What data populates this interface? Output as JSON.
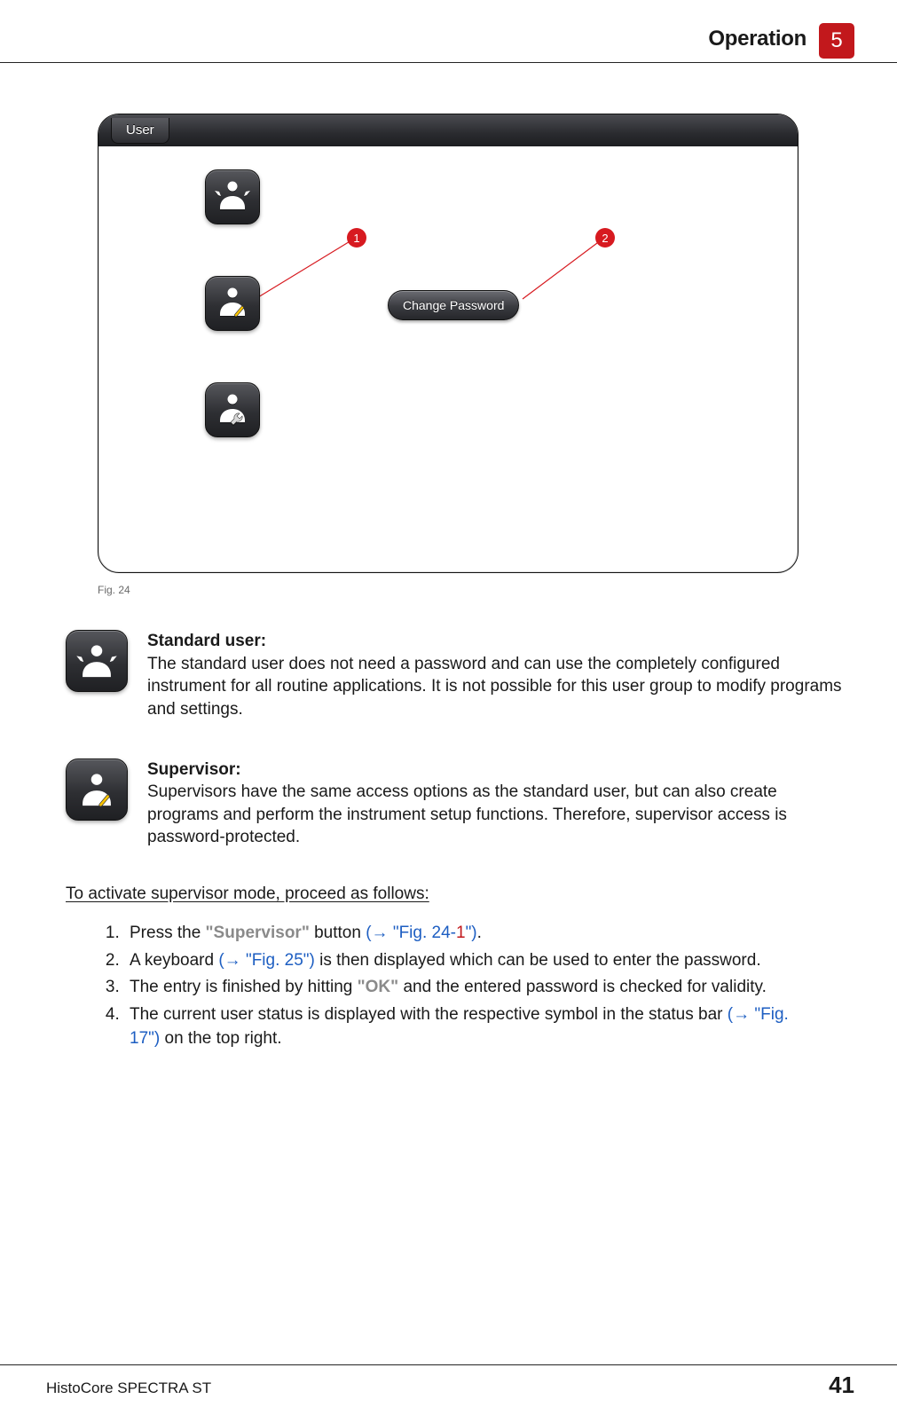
{
  "header": {
    "section_title": "Operation",
    "chapter_number": "5"
  },
  "panel": {
    "tab_label": "User",
    "change_password_label": "Change Password",
    "callout_1": "1",
    "callout_2": "2"
  },
  "figure_caption": "Fig. 24",
  "roles": {
    "standard": {
      "title": "Standard user:",
      "body": "The standard user does not need a password and can use the completely configured instrument for all routine applications. It is not possible for this user group to modify programs and settings."
    },
    "supervisor": {
      "title": "Supervisor:",
      "body": "Supervisors have the same access options as the standard user, but can also create programs and perform the instrument setup functions. Therefore, supervisor access is password-protected."
    }
  },
  "instructions": {
    "heading": "To activate supervisor mode, proceed as follows:",
    "step1_pre": "Press the ",
    "step1_btn": "\"Supervisor\"",
    "step1_mid": " button ",
    "step1_link_open": "(→ \"Fig. 24-",
    "step1_link_num": "1",
    "step1_link_close": "\")",
    "step1_after": ".",
    "step2_pre": "A keyboard ",
    "step2_link": "(→ \"Fig. 25\")",
    "step2_after": " is then displayed which can be used to enter the password.",
    "step3_pre": "The entry is finished by hitting ",
    "step3_btn": "\"OK\"",
    "step3_after": " and the entered password is checked for validity.",
    "step4_pre": "The current user status is displayed with the respective symbol in the status bar ",
    "step4_link": "(→ \"Fig. 17\")",
    "step4_after": " on the top right."
  },
  "footer": {
    "product": "HistoCore SPECTRA ST",
    "page": "41"
  }
}
